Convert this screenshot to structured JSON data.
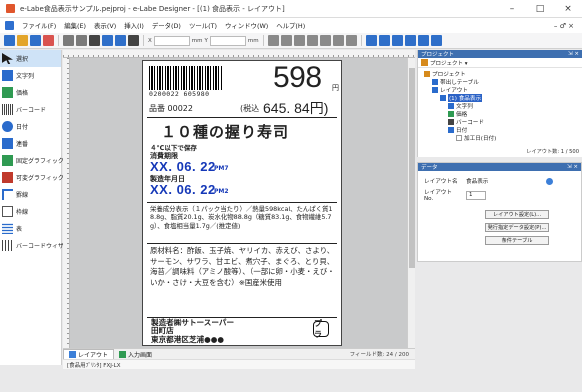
{
  "window": {
    "title": "e-Labe食品表示サンプル.pejproj - e-Labe Designer - [(1) 食品表示 - レイアウト]",
    "minimize": "–",
    "maximize": "□",
    "close": "×"
  },
  "menu": {
    "items": [
      "ファイル(F)",
      "編集(E)",
      "表示(V)",
      "挿入(I)",
      "データ(D)",
      "ツール(T)",
      "ウィンドウ(W)",
      "ヘルプ(H)"
    ],
    "right": "– ♂ ×"
  },
  "toolbar": {
    "x_label": "X",
    "x_value": "",
    "unit1": "mm",
    "y_label": "Y",
    "y_value": "",
    "unit2": "mm"
  },
  "tools": {
    "items": [
      {
        "label": "選択",
        "icon": "cursor-icon",
        "color": "#1b1b1b"
      },
      {
        "label": "文字列",
        "icon": "text-icon",
        "color": "#2a6bcc"
      },
      {
        "label": "価格",
        "icon": "price-icon",
        "color": "#2f9a52"
      },
      {
        "label": "バーコード",
        "icon": "barcode-icon",
        "color": "#444444"
      },
      {
        "label": "日付",
        "icon": "date-icon",
        "color": "#2a6bcc"
      },
      {
        "label": "連番",
        "icon": "serial-icon",
        "color": "#2a6bcc"
      },
      {
        "label": "固定グラフィック",
        "icon": "fixed-graphic-icon",
        "color": "#2f9a52"
      },
      {
        "label": "可変グラフィック",
        "icon": "variable-graphic-icon",
        "color": "#c0392b"
      },
      {
        "label": "罫線",
        "icon": "line-icon",
        "color": "#2a6bcc"
      },
      {
        "label": "枠線",
        "icon": "frame-icon",
        "color": "#555555"
      },
      {
        "label": "表",
        "icon": "table-icon",
        "color": "#2a6bcc"
      },
      {
        "label": "バーコードウィザード",
        "icon": "barcode-wizard-icon",
        "color": "#444444"
      }
    ]
  },
  "label": {
    "barcode_number": "0200022 605980",
    "price": "598",
    "price_yen": "円",
    "item_code": "品番 00022",
    "tax_label": "(税込",
    "tax_price": "645. 84円)",
    "tax_yen": "",
    "product_name": "１０種の握り寿司",
    "storage": "４℃以下で保存",
    "expiry_label": "消費期限",
    "expiry_date": "XX. 06. 22",
    "expiry_time": "PM7",
    "manufacture_label": "製造年月日",
    "manufacture_date": "XX. 06. 22",
    "manufacture_time": "PM2",
    "nutrition": "栄養成分表示（１パック当たり）／熱量598kcal、たんぱく質18.8g、脂質20.1g、炭水化物88.8g（糖質83.1g、食物繊維5.7g）、食塩相当量1.7g／(推定値)",
    "ingredients": "原材料名：酢飯、玉子焼、ヤリイカ、赤えび、さより、サーモン、サワラ、甘エビ、煮穴子、まぐろ、とり貝、海苔／調味料（アミノ酸等）、（一部に卵・小麦・えび・いか・さけ・大豆を含む）※国産米使用",
    "maker_1": "製造者㈱サトースーパー",
    "maker_2": "田町店",
    "maker_3": "東京都港区芝浦●●●",
    "recycle_mark": "プラ"
  },
  "canvas_tabs": {
    "layout": "レイアウト",
    "input": "入力画面",
    "field_count": "フィールド数: 24 / 200"
  },
  "status": {
    "printer": "[食品用ﾌﾟﾘﾝﾀ] FXJ-LX"
  },
  "project_panel": {
    "title": "プロジェクト",
    "pin": "⇲ ×",
    "tool_label": "プロジェクト ▾",
    "tree": [
      {
        "label": "プロジェクト",
        "depth": 0,
        "icon": "project-icon",
        "color": "#d68a1c"
      },
      {
        "label": "帯出しテーブル",
        "depth": 1,
        "icon": "table-icon",
        "color": "#2a6bcc"
      },
      {
        "label": "レイアウト",
        "depth": 1,
        "icon": "layout-icon",
        "color": "#2a6bcc"
      },
      {
        "label": "(1) 食品表示",
        "depth": 2,
        "icon": "page-icon",
        "color": "#2a6bcc",
        "selected": true
      },
      {
        "label": "文字列",
        "depth": 3,
        "icon": "text-icon",
        "color": "#2a6bcc"
      },
      {
        "label": "価格",
        "depth": 3,
        "icon": "price-icon",
        "color": "#2f9a52"
      },
      {
        "label": "バーコード",
        "depth": 3,
        "icon": "barcode-icon",
        "color": "#444444"
      },
      {
        "label": "日付",
        "depth": 3,
        "icon": "date-icon",
        "color": "#2a6bcc"
      },
      {
        "label": "加工日(日付)",
        "depth": 4,
        "icon": "date-icon",
        "color": "#2a6bcc"
      }
    ],
    "footer": "レイアウト数: 1 / 500"
  },
  "data_panel": {
    "title": "データ",
    "pin": "⇲ ×",
    "layout_name_label": "レイアウト名",
    "layout_name_value": "食品表示",
    "layout_no_label": "レイアウトNo.",
    "layout_no_value": "1",
    "btn_layout_settings": "レイアウト設定(L)...",
    "btn_print_settings": "発行指定データ設定(P)...",
    "btn_condition_table": "条件テーブル"
  }
}
